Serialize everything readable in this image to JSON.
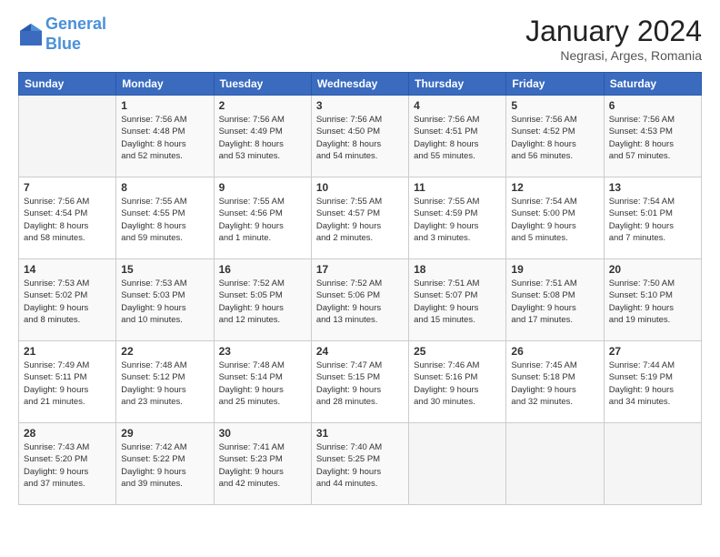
{
  "header": {
    "logo_line1": "General",
    "logo_line2": "Blue",
    "month_year": "January 2024",
    "location": "Negrasi, Arges, Romania"
  },
  "days_of_week": [
    "Sunday",
    "Monday",
    "Tuesday",
    "Wednesday",
    "Thursday",
    "Friday",
    "Saturday"
  ],
  "weeks": [
    [
      {
        "day": "",
        "info": ""
      },
      {
        "day": "1",
        "info": "Sunrise: 7:56 AM\nSunset: 4:48 PM\nDaylight: 8 hours\nand 52 minutes."
      },
      {
        "day": "2",
        "info": "Sunrise: 7:56 AM\nSunset: 4:49 PM\nDaylight: 8 hours\nand 53 minutes."
      },
      {
        "day": "3",
        "info": "Sunrise: 7:56 AM\nSunset: 4:50 PM\nDaylight: 8 hours\nand 54 minutes."
      },
      {
        "day": "4",
        "info": "Sunrise: 7:56 AM\nSunset: 4:51 PM\nDaylight: 8 hours\nand 55 minutes."
      },
      {
        "day": "5",
        "info": "Sunrise: 7:56 AM\nSunset: 4:52 PM\nDaylight: 8 hours\nand 56 minutes."
      },
      {
        "day": "6",
        "info": "Sunrise: 7:56 AM\nSunset: 4:53 PM\nDaylight: 8 hours\nand 57 minutes."
      }
    ],
    [
      {
        "day": "7",
        "info": "Sunrise: 7:56 AM\nSunset: 4:54 PM\nDaylight: 8 hours\nand 58 minutes."
      },
      {
        "day": "8",
        "info": "Sunrise: 7:55 AM\nSunset: 4:55 PM\nDaylight: 8 hours\nand 59 minutes."
      },
      {
        "day": "9",
        "info": "Sunrise: 7:55 AM\nSunset: 4:56 PM\nDaylight: 9 hours\nand 1 minute."
      },
      {
        "day": "10",
        "info": "Sunrise: 7:55 AM\nSunset: 4:57 PM\nDaylight: 9 hours\nand 2 minutes."
      },
      {
        "day": "11",
        "info": "Sunrise: 7:55 AM\nSunset: 4:59 PM\nDaylight: 9 hours\nand 3 minutes."
      },
      {
        "day": "12",
        "info": "Sunrise: 7:54 AM\nSunset: 5:00 PM\nDaylight: 9 hours\nand 5 minutes."
      },
      {
        "day": "13",
        "info": "Sunrise: 7:54 AM\nSunset: 5:01 PM\nDaylight: 9 hours\nand 7 minutes."
      }
    ],
    [
      {
        "day": "14",
        "info": "Sunrise: 7:53 AM\nSunset: 5:02 PM\nDaylight: 9 hours\nand 8 minutes."
      },
      {
        "day": "15",
        "info": "Sunrise: 7:53 AM\nSunset: 5:03 PM\nDaylight: 9 hours\nand 10 minutes."
      },
      {
        "day": "16",
        "info": "Sunrise: 7:52 AM\nSunset: 5:05 PM\nDaylight: 9 hours\nand 12 minutes."
      },
      {
        "day": "17",
        "info": "Sunrise: 7:52 AM\nSunset: 5:06 PM\nDaylight: 9 hours\nand 13 minutes."
      },
      {
        "day": "18",
        "info": "Sunrise: 7:51 AM\nSunset: 5:07 PM\nDaylight: 9 hours\nand 15 minutes."
      },
      {
        "day": "19",
        "info": "Sunrise: 7:51 AM\nSunset: 5:08 PM\nDaylight: 9 hours\nand 17 minutes."
      },
      {
        "day": "20",
        "info": "Sunrise: 7:50 AM\nSunset: 5:10 PM\nDaylight: 9 hours\nand 19 minutes."
      }
    ],
    [
      {
        "day": "21",
        "info": "Sunrise: 7:49 AM\nSunset: 5:11 PM\nDaylight: 9 hours\nand 21 minutes."
      },
      {
        "day": "22",
        "info": "Sunrise: 7:48 AM\nSunset: 5:12 PM\nDaylight: 9 hours\nand 23 minutes."
      },
      {
        "day": "23",
        "info": "Sunrise: 7:48 AM\nSunset: 5:14 PM\nDaylight: 9 hours\nand 25 minutes."
      },
      {
        "day": "24",
        "info": "Sunrise: 7:47 AM\nSunset: 5:15 PM\nDaylight: 9 hours\nand 28 minutes."
      },
      {
        "day": "25",
        "info": "Sunrise: 7:46 AM\nSunset: 5:16 PM\nDaylight: 9 hours\nand 30 minutes."
      },
      {
        "day": "26",
        "info": "Sunrise: 7:45 AM\nSunset: 5:18 PM\nDaylight: 9 hours\nand 32 minutes."
      },
      {
        "day": "27",
        "info": "Sunrise: 7:44 AM\nSunset: 5:19 PM\nDaylight: 9 hours\nand 34 minutes."
      }
    ],
    [
      {
        "day": "28",
        "info": "Sunrise: 7:43 AM\nSunset: 5:20 PM\nDaylight: 9 hours\nand 37 minutes."
      },
      {
        "day": "29",
        "info": "Sunrise: 7:42 AM\nSunset: 5:22 PM\nDaylight: 9 hours\nand 39 minutes."
      },
      {
        "day": "30",
        "info": "Sunrise: 7:41 AM\nSunset: 5:23 PM\nDaylight: 9 hours\nand 42 minutes."
      },
      {
        "day": "31",
        "info": "Sunrise: 7:40 AM\nSunset: 5:25 PM\nDaylight: 9 hours\nand 44 minutes."
      },
      {
        "day": "",
        "info": ""
      },
      {
        "day": "",
        "info": ""
      },
      {
        "day": "",
        "info": ""
      }
    ]
  ]
}
